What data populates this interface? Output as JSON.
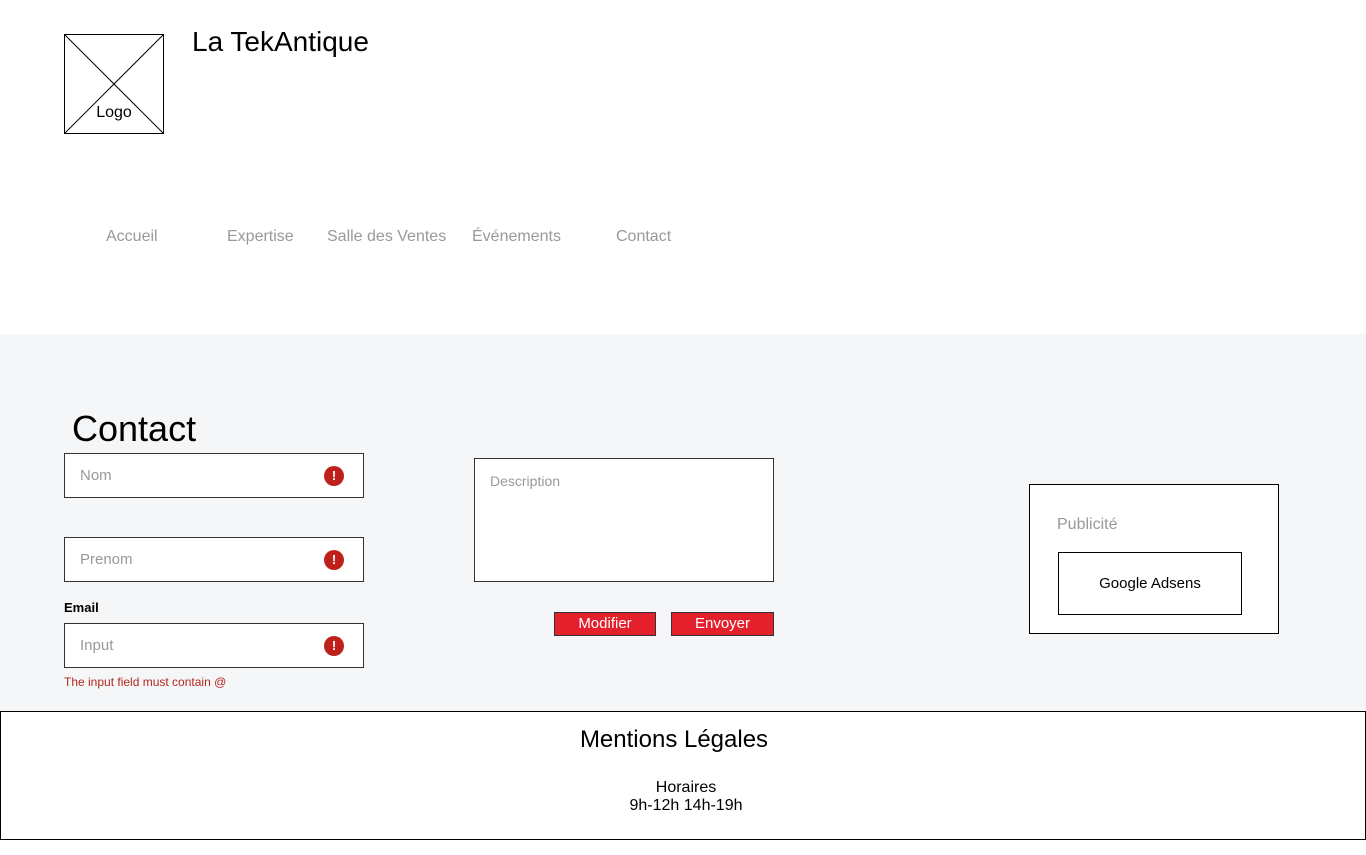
{
  "header": {
    "logo_label": "Logo",
    "site_title": "La TekAntique"
  },
  "nav": {
    "items": [
      {
        "label": "Accueil"
      },
      {
        "label": "Expertise"
      },
      {
        "label": "Salle des Ventes"
      },
      {
        "label": "Événements"
      },
      {
        "label": "Contact"
      }
    ]
  },
  "contact": {
    "heading": "Contact",
    "nom_placeholder": "Nom",
    "prenom_placeholder": "Prenom",
    "email_label": "Email",
    "email_placeholder": "Input",
    "email_error": "The input field must contain @",
    "description_placeholder": "Description",
    "modifier_label": "Modifier",
    "envoyer_label": "Envoyer",
    "error_icon_glyph": "!"
  },
  "ad": {
    "label": "Publicité",
    "inner_label": "Google Adsens"
  },
  "footer": {
    "title": "Mentions Légales",
    "hours_label": "Horaires",
    "hours_value": "9h-12h 14h-19h"
  },
  "colors": {
    "accent_button": "#e3202b",
    "error": "#c0201a",
    "muted_text": "#999999",
    "main_background": "#f5f6f8"
  }
}
